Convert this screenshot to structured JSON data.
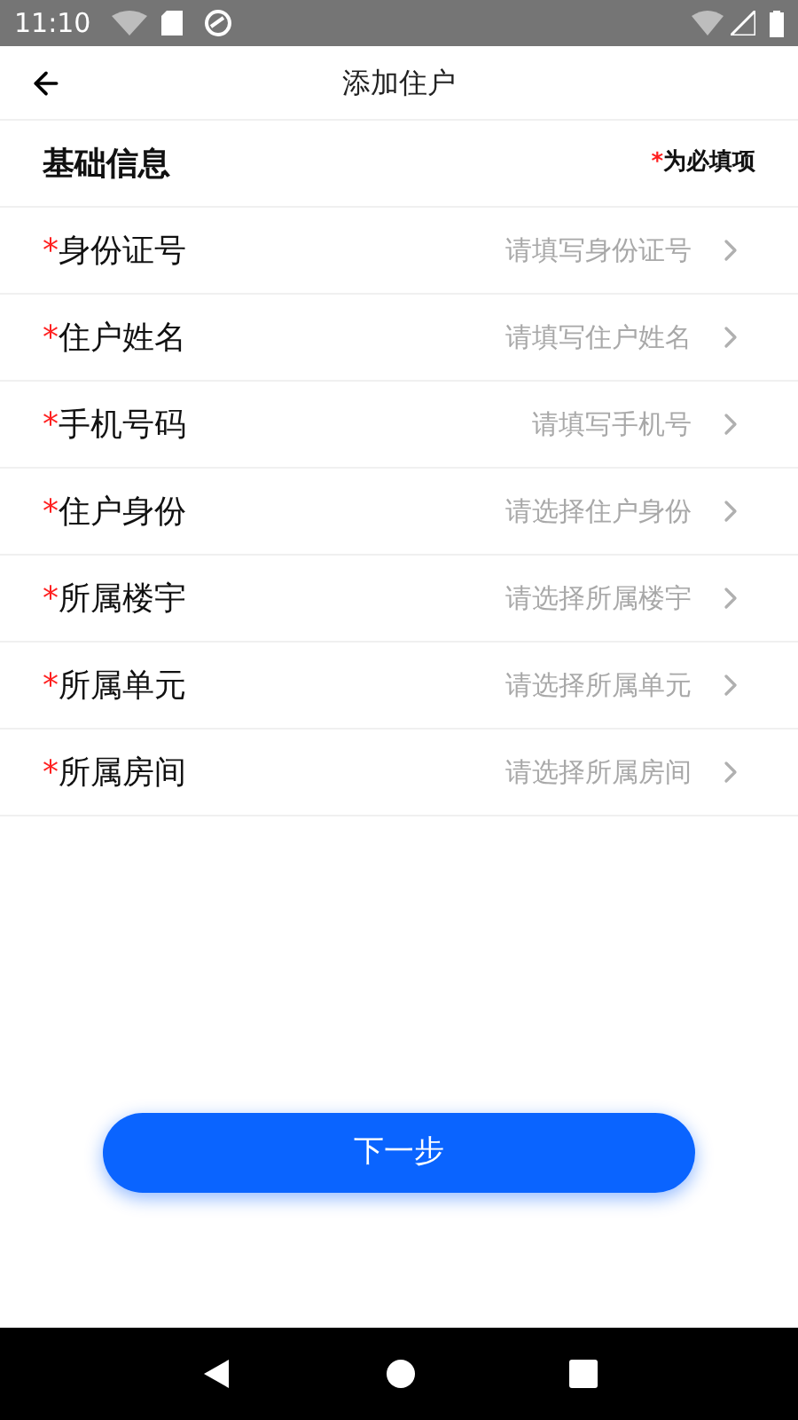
{
  "status_bar": {
    "time": "11:10"
  },
  "header": {
    "title": "添加住户"
  },
  "section": {
    "title": "基础信息",
    "note_mark": "*",
    "note": "为必填项"
  },
  "fields": [
    {
      "mark": "*",
      "label": "身份证号",
      "placeholder": "请填写身份证号"
    },
    {
      "mark": "*",
      "label": "住户姓名",
      "placeholder": "请填写住户姓名"
    },
    {
      "mark": "*",
      "label": "手机号码",
      "placeholder": "请填写手机号"
    },
    {
      "mark": "*",
      "label": "住户身份",
      "placeholder": "请选择住户身份"
    },
    {
      "mark": "*",
      "label": "所属楼宇",
      "placeholder": "请选择所属楼宇"
    },
    {
      "mark": "*",
      "label": "所属单元",
      "placeholder": "请选择所属单元"
    },
    {
      "mark": "*",
      "label": "所属房间",
      "placeholder": "请选择所属房间"
    }
  ],
  "next_button": "下一步"
}
